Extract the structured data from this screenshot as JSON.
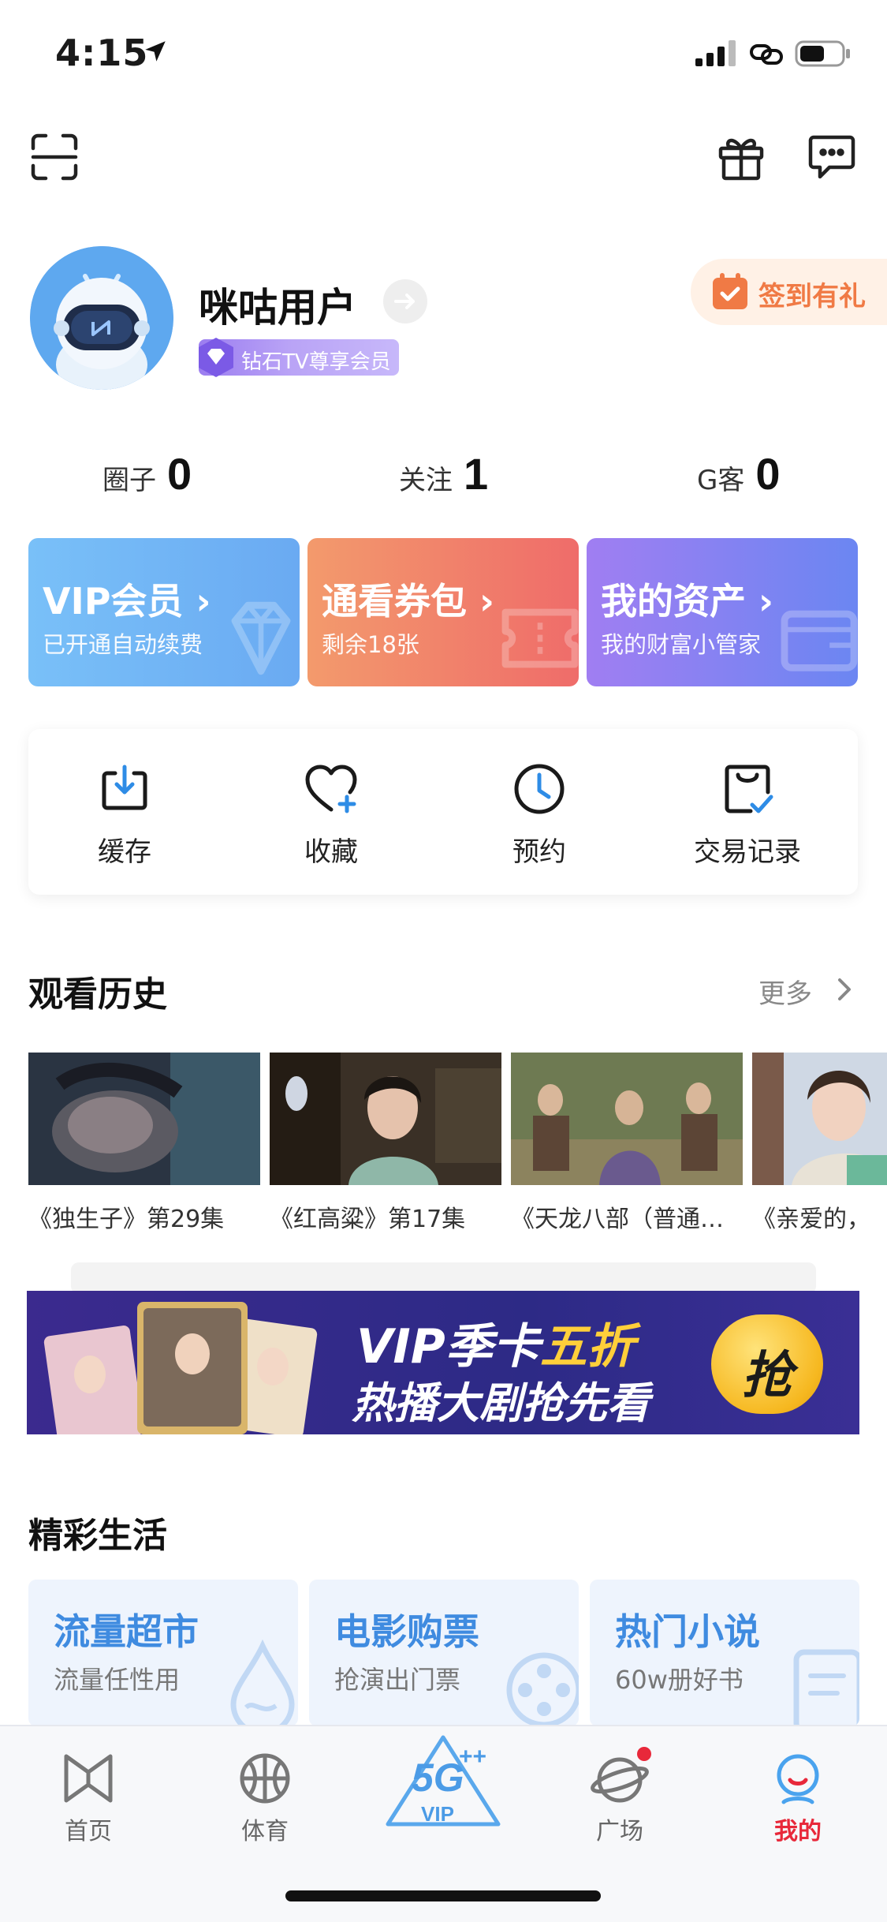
{
  "status_bar": {
    "time": "4:15"
  },
  "profile": {
    "username": "咪咕用户",
    "vip_badge": "钻石TV尊享会员",
    "checkin": "签到有礼"
  },
  "stats": [
    {
      "label": "圈子",
      "value": "0"
    },
    {
      "label": "关注",
      "value": "1"
    },
    {
      "label": "G客",
      "value": "0"
    }
  ],
  "cards": [
    {
      "title": "VIP会员 ›",
      "subtitle": "已开通自动续费"
    },
    {
      "title": "通看券包 ›",
      "subtitle": "剩余18张"
    },
    {
      "title": "我的资产 ›",
      "subtitle": "我的财富小管家"
    }
  ],
  "actions": [
    {
      "label": "缓存",
      "icon": "download-icon"
    },
    {
      "label": "收藏",
      "icon": "heart-plus-icon"
    },
    {
      "label": "预约",
      "icon": "clock-icon"
    },
    {
      "label": "交易记录",
      "icon": "receipt-check-icon"
    }
  ],
  "history": {
    "title": "观看历史",
    "more": "更多",
    "items": [
      {
        "caption": "《独生子》第29集"
      },
      {
        "caption": "《红高粱》第17集"
      },
      {
        "caption": "《天龙八部（普通…"
      },
      {
        "caption": "《亲爱的，"
      }
    ]
  },
  "banner": {
    "line1_a": "VIP季卡",
    "line1_b": "五折",
    "line2": "热播大剧抢先看",
    "button": "抢"
  },
  "life": {
    "title": "精彩生活",
    "items": [
      {
        "title": "流量超市",
        "subtitle": "流量任性用"
      },
      {
        "title": "电影购票",
        "subtitle": "抢演出门票"
      },
      {
        "title": "热门小说",
        "subtitle": "60w册好书"
      }
    ]
  },
  "tabbar": {
    "items": [
      {
        "label": "首页"
      },
      {
        "label": "体育"
      },
      {
        "label": "广场"
      },
      {
        "label": "我的"
      }
    ],
    "center_label": "5G VIP"
  },
  "colors": {
    "accent_red": "#e8283a",
    "life_title_blue": "#3f8be0",
    "checkin_orange": "#f07a45"
  }
}
